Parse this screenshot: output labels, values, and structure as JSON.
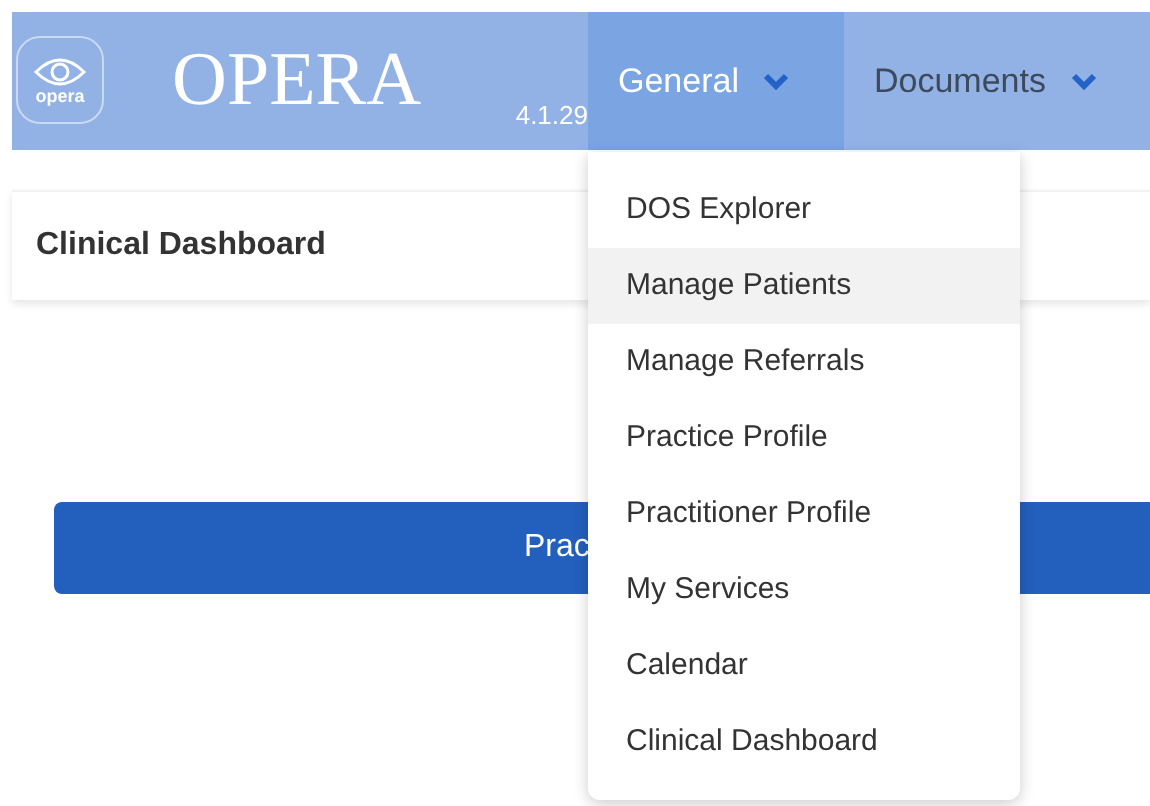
{
  "header": {
    "logo_text": "opera",
    "title": "OPERA",
    "version": "4.1.29"
  },
  "menus": [
    {
      "label": "General",
      "selected": true
    },
    {
      "label": "Documents",
      "selected": false
    }
  ],
  "page": {
    "title": "Clinical Dashboard",
    "button": "Prac"
  },
  "dropdown": {
    "items": [
      {
        "label": "DOS Explorer",
        "selected": false
      },
      {
        "label": "Manage Patients",
        "selected": true
      },
      {
        "label": "Manage Referrals",
        "selected": false
      },
      {
        "label": "Practice Profile",
        "selected": false
      },
      {
        "label": "Practitioner Profile",
        "selected": false
      },
      {
        "label": "My Services",
        "selected": false
      },
      {
        "label": "Calendar",
        "selected": false
      },
      {
        "label": "Clinical Dashboard",
        "selected": false
      }
    ]
  }
}
